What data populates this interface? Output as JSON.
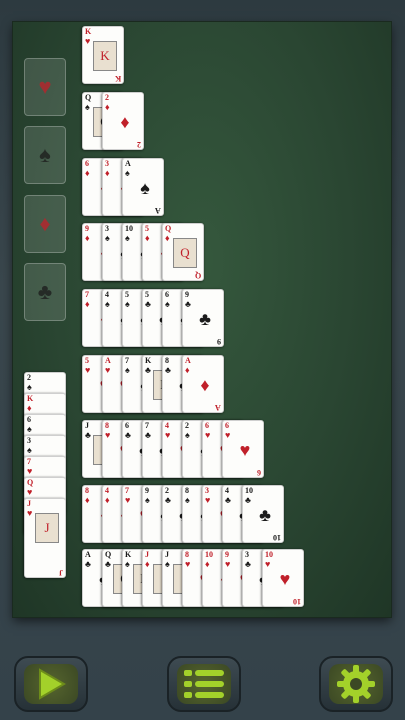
{
  "colors": {
    "felt": "#2a4632",
    "red": "#c0202a",
    "black": "#1b1b1b",
    "button_green": "#a3d12a"
  },
  "foundations": [
    {
      "suit": "♥",
      "color": "red",
      "icon": "heart-icon"
    },
    {
      "suit": "♠",
      "color": "blk",
      "icon": "spade-icon"
    },
    {
      "suit": "♦",
      "color": "red",
      "icon": "diamond-icon"
    },
    {
      "suit": "♣",
      "color": "blk",
      "icon": "club-icon"
    }
  ],
  "rows": [
    [
      {
        "r": "K",
        "s": "♥",
        "c": "red",
        "f": true
      }
    ],
    [
      {
        "r": "Q",
        "s": "♠",
        "c": "blk",
        "f": true
      },
      {
        "r": "2",
        "s": "♦",
        "c": "red"
      }
    ],
    [
      {
        "r": "6",
        "s": "♦",
        "c": "red"
      },
      {
        "r": "3",
        "s": "♦",
        "c": "red"
      },
      {
        "r": "A",
        "s": "♠",
        "c": "blk"
      }
    ],
    [
      {
        "r": "9",
        "s": "♦",
        "c": "red"
      },
      {
        "r": "3",
        "s": "♠",
        "c": "blk"
      },
      {
        "r": "10",
        "s": "♠",
        "c": "blk"
      },
      {
        "r": "5",
        "s": "♦",
        "c": "red"
      },
      {
        "r": "Q",
        "s": "♦",
        "c": "red",
        "f": true
      }
    ],
    [
      {
        "r": "7",
        "s": "♦",
        "c": "red"
      },
      {
        "r": "4",
        "s": "♠",
        "c": "blk"
      },
      {
        "r": "5",
        "s": "♠",
        "c": "blk"
      },
      {
        "r": "5",
        "s": "♣",
        "c": "blk"
      },
      {
        "r": "6",
        "s": "♠",
        "c": "blk"
      },
      {
        "r": "9",
        "s": "♣",
        "c": "blk"
      }
    ],
    [
      {
        "r": "5",
        "s": "♥",
        "c": "red"
      },
      {
        "r": "A",
        "s": "♥",
        "c": "red"
      },
      {
        "r": "7",
        "s": "♠",
        "c": "blk"
      },
      {
        "r": "K",
        "s": "♣",
        "c": "blk",
        "f": true
      },
      {
        "r": "8",
        "s": "♣",
        "c": "blk"
      },
      {
        "r": "A",
        "s": "♦",
        "c": "red"
      }
    ],
    [
      {
        "r": "J",
        "s": "♣",
        "c": "blk",
        "f": true
      },
      {
        "r": "8",
        "s": "♥",
        "c": "red"
      },
      {
        "r": "6",
        "s": "♣",
        "c": "blk"
      },
      {
        "r": "7",
        "s": "♣",
        "c": "blk"
      },
      {
        "r": "4",
        "s": "♥",
        "c": "red"
      },
      {
        "r": "2",
        "s": "♠",
        "c": "blk"
      },
      {
        "r": "6",
        "s": "♥",
        "c": "red"
      },
      {
        "r": "6",
        "s": "♥",
        "c": "red"
      }
    ],
    [
      {
        "r": "8",
        "s": "♦",
        "c": "red"
      },
      {
        "r": "4",
        "s": "♦",
        "c": "red"
      },
      {
        "r": "7",
        "s": "♥",
        "c": "red"
      },
      {
        "r": "9",
        "s": "♠",
        "c": "blk"
      },
      {
        "r": "2",
        "s": "♣",
        "c": "blk"
      },
      {
        "r": "8",
        "s": "♠",
        "c": "blk"
      },
      {
        "r": "3",
        "s": "♥",
        "c": "red"
      },
      {
        "r": "4",
        "s": "♣",
        "c": "blk"
      },
      {
        "r": "10",
        "s": "♣",
        "c": "blk"
      }
    ],
    [
      {
        "r": "A",
        "s": "♣",
        "c": "blk"
      },
      {
        "r": "Q",
        "s": "♣",
        "c": "blk",
        "f": true
      },
      {
        "r": "K",
        "s": "♠",
        "c": "blk",
        "f": true
      },
      {
        "r": "J",
        "s": "♦",
        "c": "red",
        "f": true
      },
      {
        "r": "J",
        "s": "♠",
        "c": "blk",
        "f": true
      },
      {
        "r": "8",
        "s": "♥",
        "c": "red"
      },
      {
        "r": "10",
        "s": "♦",
        "c": "red"
      },
      {
        "r": "9",
        "s": "♥",
        "c": "red"
      },
      {
        "r": "3",
        "s": "♣",
        "c": "blk"
      },
      {
        "r": "10",
        "s": "♥",
        "c": "red"
      }
    ]
  ],
  "stock": [
    {
      "r": "2",
      "s": "♠",
      "c": "blk"
    },
    {
      "r": "K",
      "s": "♦",
      "c": "red"
    },
    {
      "r": "6",
      "s": "♠",
      "c": "blk"
    },
    {
      "r": "3",
      "s": "♠",
      "c": "blk"
    },
    {
      "r": "7",
      "s": "♥",
      "c": "red"
    },
    {
      "r": "Q",
      "s": "♥",
      "c": "red"
    },
    {
      "r": "J",
      "s": "♥",
      "c": "red",
      "f": true
    }
  ],
  "buttons": [
    {
      "name": "play-button",
      "icon": "play-icon"
    },
    {
      "name": "menu-button",
      "icon": "menu-icon"
    },
    {
      "name": "settings-button",
      "icon": "gear-icon"
    }
  ]
}
